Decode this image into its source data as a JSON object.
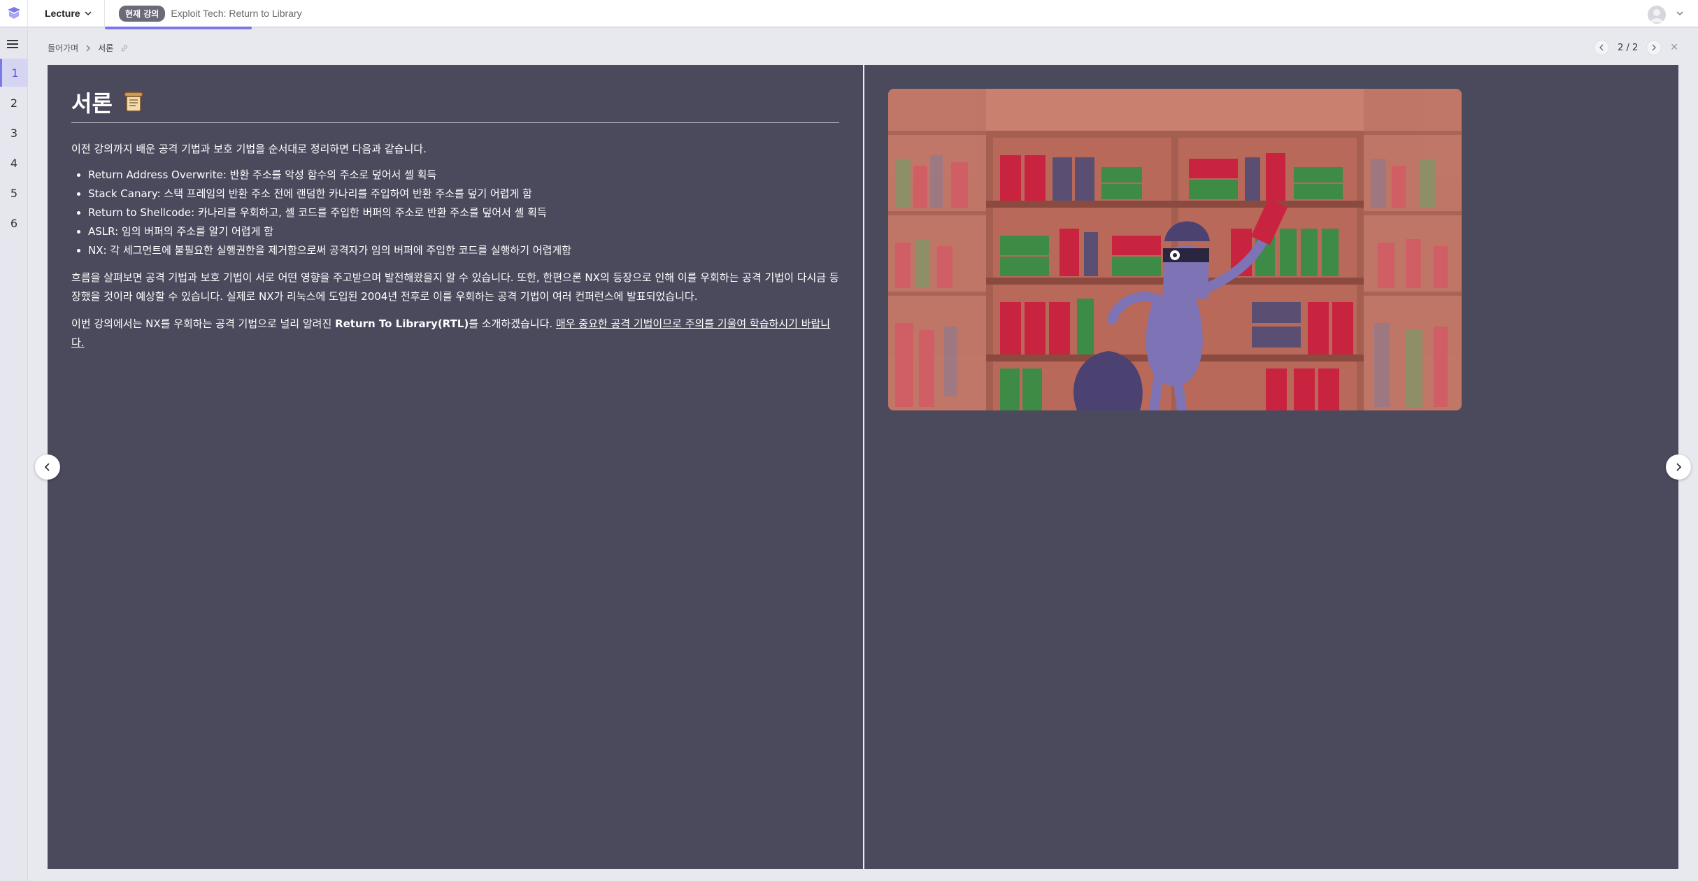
{
  "topbar": {
    "lecture_label": "Lecture",
    "current_badge": "현재 강의",
    "course_title": "Exploit Tech: Return to Library"
  },
  "rail": {
    "steps": [
      "1",
      "2",
      "3",
      "4",
      "5",
      "6"
    ],
    "active_step": "1"
  },
  "breadcrumb": {
    "parent": "들어가며",
    "current": "서론"
  },
  "pager": {
    "text": "2 / 2"
  },
  "content": {
    "title": "서론",
    "title_emoji": "📜",
    "intro": "이전 강의까지 배운 공격 기법과 보호 기법을 순서대로 정리하면 다음과 같습니다.",
    "bullets": [
      "Return Address Overwrite: 반환 주소를 악성 함수의 주소로 덮어서 셸 획득",
      "Stack Canary: 스택 프레임의 반환 주소 전에 랜덤한 카나리를 주입하여 반환 주소를 덮기 어렵게 함",
      "Return to Shellcode: 카나리를 우회하고, 셸 코드를 주입한 버퍼의 주소로 반환 주소를 덮어서 셸 획득",
      "ASLR: 임의 버퍼의 주소를 알기 어렵게 함",
      "NX: 각 세그먼트에 불필요한 실행권한을 제거함으로써 공격자가 임의 버퍼에 주입한 코드를 실행하기 어렵게함"
    ],
    "para2": "흐름을 살펴보면 공격 기법과 보호 기법이 서로 어떤 영향을 주고받으며 발전해왔을지 알 수 있습니다. 또한, 한편으론 NX의 등장으로 인해 이를 우회하는 공격 기법이 다시금 등장했을 것이라 예상할 수 있습니다. 실제로 NX가 리눅스에 도입된 2004년 전후로 이를 우회하는 공격 기법이 여러 컨퍼런스에 발표되었습니다.",
    "para3_a": "이번 강의에서는 NX를 우회하는 공격 기법으로 널리 알려진 ",
    "para3_b": "Return To Library(RTL)",
    "para3_c": "를 소개하겠습니다. ",
    "para3_d": "매우 중요한 공격 기법이므로 주의를 기울여 학습하시기 바랍니다."
  },
  "colors": {
    "accent": "#7b78e8",
    "slide_bg": "#4b4a5d",
    "bookshelf_bg": "#c9806f"
  },
  "icons": [
    "app-logo-icon",
    "chevron-down-icon",
    "menu-icon",
    "link-icon",
    "chevron-left-icon",
    "chevron-right-icon",
    "close-icon",
    "user-avatar-icon"
  ]
}
